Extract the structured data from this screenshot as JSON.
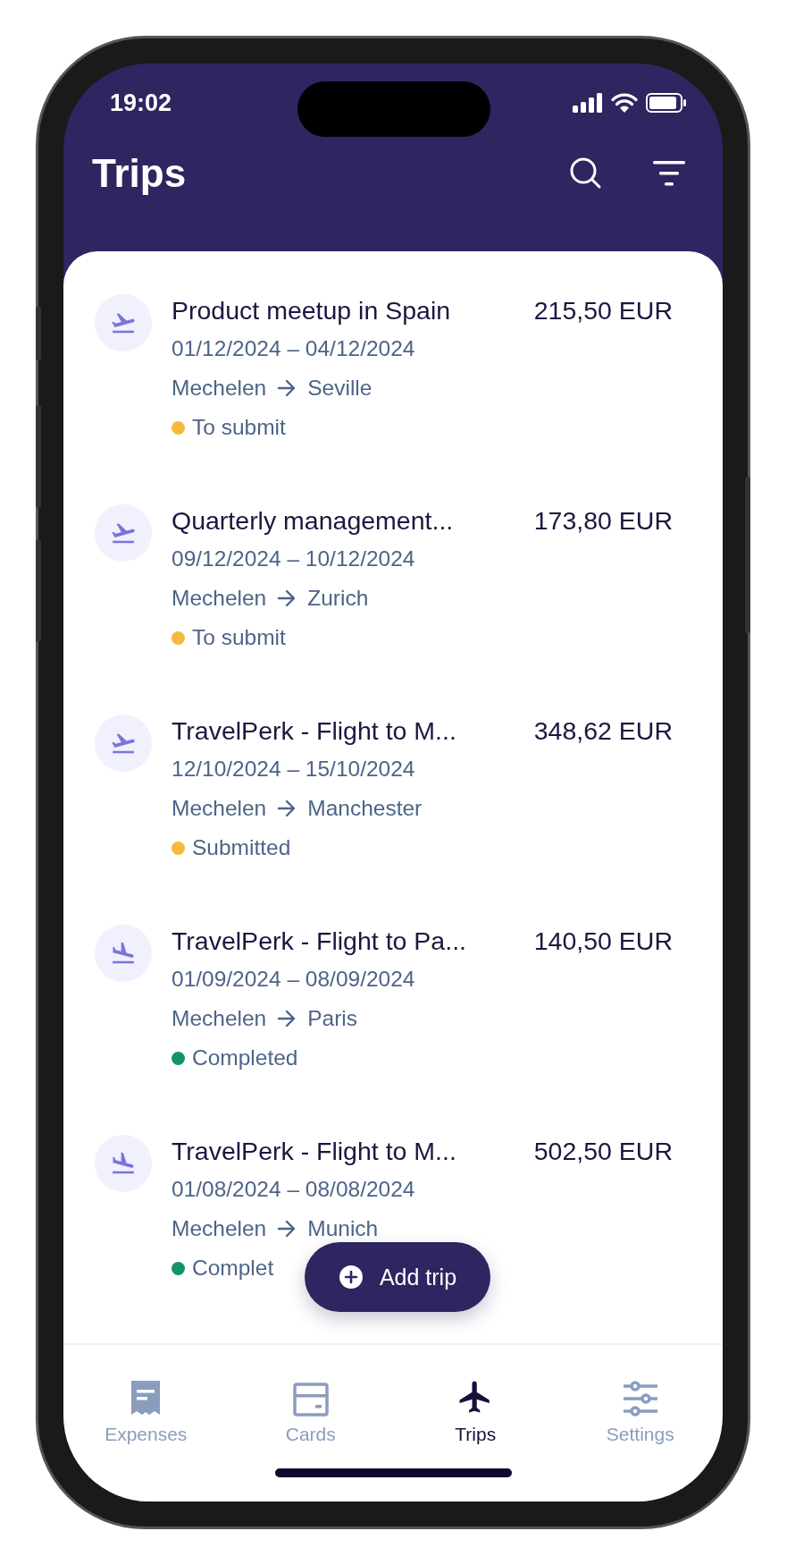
{
  "status_bar": {
    "time": "19:02"
  },
  "header": {
    "title": "Trips"
  },
  "trips": [
    {
      "title": "Product meetup in Spain",
      "amount": "215,50 EUR",
      "dates": "01/12/2024 – 04/12/2024",
      "from": "Mechelen",
      "to": "Seville",
      "status": "To submit",
      "color": "#f5b93b",
      "kind": "takeoff"
    },
    {
      "title": "Quarterly management...",
      "amount": "173,80 EUR",
      "dates": "09/12/2024 – 10/12/2024",
      "from": "Mechelen",
      "to": "Zurich",
      "status": "To submit",
      "color": "#f5b93b",
      "kind": "takeoff"
    },
    {
      "title": "TravelPerk - Flight to M...",
      "amount": "348,62 EUR",
      "dates": "12/10/2024 – 15/10/2024",
      "from": "Mechelen",
      "to": "Manchester",
      "status": "Submitted",
      "color": "#f5b93b",
      "kind": "takeoff"
    },
    {
      "title": "TravelPerk - Flight to Pa...",
      "amount": "140,50 EUR",
      "dates": "01/09/2024 – 08/09/2024",
      "from": "Mechelen",
      "to": "Paris",
      "status": "Completed",
      "color": "#149465",
      "kind": "landing"
    },
    {
      "title": "TravelPerk - Flight to M...",
      "amount": "502,50 EUR",
      "dates": "01/08/2024 – 08/08/2024",
      "from": "Mechelen",
      "to": "Munich",
      "status": "Complet",
      "color": "#149465",
      "kind": "landing"
    }
  ],
  "add_button": {
    "label": "Add trip"
  },
  "tabs": [
    {
      "label": "Expenses",
      "kind": "expenses",
      "selected": false
    },
    {
      "label": "Cards",
      "kind": "cards",
      "selected": false
    },
    {
      "label": "Trips",
      "kind": "trips",
      "selected": true
    },
    {
      "label": "Settings",
      "kind": "settings",
      "selected": false
    }
  ]
}
